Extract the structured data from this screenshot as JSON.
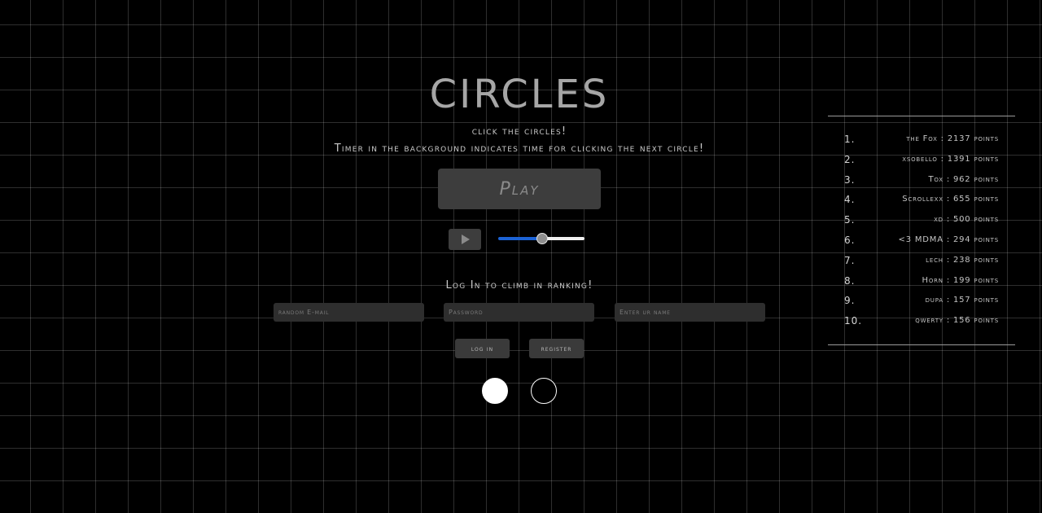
{
  "app": {
    "title": "CIRCLES",
    "subtitle_line1": "click the circles!",
    "subtitle_line2": "Timer in the background indicates time for clicking the next circle!"
  },
  "controls": {
    "play_label": "Play",
    "music_icon": "play-triangle-icon",
    "volume_level": 0.5
  },
  "login": {
    "heading": "Log In to climb in ranking!",
    "email_placeholder": "random E-mail",
    "password_placeholder": "Password",
    "name_placeholder": "Enter ur name",
    "login_label": "log in",
    "register_label": "register"
  },
  "circles": [
    {
      "style": "filled",
      "color": "#ffffff"
    },
    {
      "style": "outline",
      "color": "#ffffff"
    }
  ],
  "ranking": [
    {
      "rank": "1.",
      "entry": "the Fox : 2137 points"
    },
    {
      "rank": "2.",
      "entry": "xsobello : 1391 points"
    },
    {
      "rank": "3.",
      "entry": "Tox : 962 points"
    },
    {
      "rank": "4.",
      "entry": "Scrollexx : 655 points"
    },
    {
      "rank": "5.",
      "entry": "xd : 500 points"
    },
    {
      "rank": "6.",
      "entry": "<3 MDMA : 294 points"
    },
    {
      "rank": "7.",
      "entry": "lech : 238 points"
    },
    {
      "rank": "8.",
      "entry": "Horn : 199 points"
    },
    {
      "rank": "9.",
      "entry": "dupa : 157 points"
    },
    {
      "rank": "10.",
      "entry": "qwerty : 156 points"
    }
  ],
  "colors": {
    "background": "#000000",
    "grid": "#4a4a4a",
    "button": "#3d3d3d",
    "slider_fill": "#1c63d6"
  }
}
